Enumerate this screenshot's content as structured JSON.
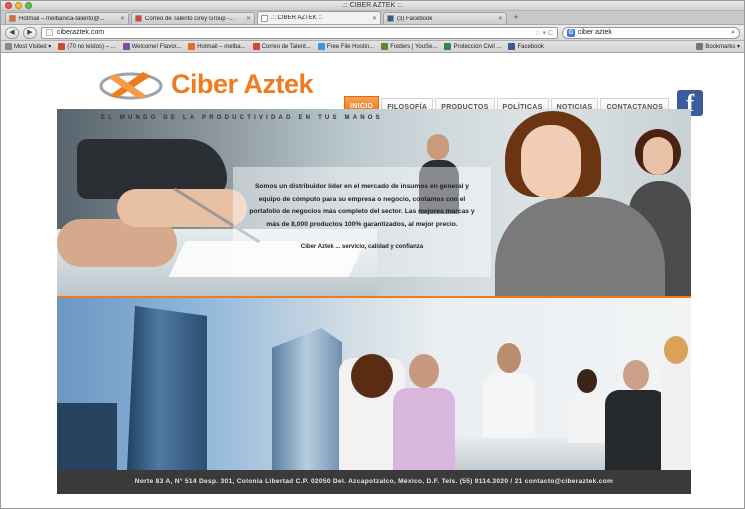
{
  "window": {
    "title": ".:: CIBER AZTEK ::."
  },
  "tabs": [
    {
      "label": "Hotmail – melbanica-talento@...",
      "icon_color": "#e56b2b"
    },
    {
      "label": "Correo de Talento Grey Group -...",
      "icon_color": "#d14836"
    },
    {
      "label": ".:: CIBER AZTEK ::.",
      "icon_color": "#ffffff",
      "active": true
    },
    {
      "label": "(3) Facebook",
      "icon_color": "#3b5998"
    }
  ],
  "navbar": {
    "back": "◀",
    "forward": "▶",
    "url": "ciberaztek.com",
    "url_controls": "☆ ▾ C",
    "search_value": "ciber aztek",
    "search_engine": "G"
  },
  "bookmarks": [
    {
      "label": "Most Visited ▾",
      "icon_color": "#8a8a8a"
    },
    {
      "label": "(70 no leídos) – ...",
      "icon_color": "#d14836"
    },
    {
      "label": "Welcome! Flavor...",
      "icon_color": "#7b4fa0"
    },
    {
      "label": "Hotmail – melba...",
      "icon_color": "#e56b2b"
    },
    {
      "label": "Correo de Talent...",
      "icon_color": "#d14836"
    },
    {
      "label": "Free File Hostin...",
      "icon_color": "#3a9ad9"
    },
    {
      "label": "Folders | YouSe...",
      "icon_color": "#5c8a2f"
    },
    {
      "label": "Protección Civil ...",
      "icon_color": "#2f8a4a"
    },
    {
      "label": "Facebook",
      "icon_color": "#3b5998"
    }
  ],
  "bookmarks_menu": "Bookmarks ▾",
  "site": {
    "brand": "Ciber Aztek",
    "nav": [
      "INICIO",
      "FILOSOFÍA",
      "PRODUCTOS",
      "POLÍTICAS",
      "NOTICIAS",
      "CONTACTANOS"
    ],
    "active_nav": "INICIO",
    "facebook_glyph": "f",
    "tagline": "EL MUNDO DE LA PRODUCTIVIDAD EN TUS MANOS",
    "intro": "Somos un distribuidor líder en el mercado de insumos en general y equipo de cómputo para su empresa o negocio, contamos con el portafolio de negocios más completo del sector. Las mejores marcas y más de 8,000 productos 100% garantizados, al mejor precio.",
    "slogan": "Ciber Aztek ... servicio, calidad y confianza",
    "footer": "Norte 83 A, N° 514 Desp. 301, Colonia Libertad  C.P. 02050 Del.  Azcapotzalco,  México, D.F.   Tels. (55) 9114.3020 / 21   contacto@ciberaztek.com",
    "colors": {
      "accent": "#f07a1f",
      "footer_bg": "#3a3a3a",
      "facebook": "#3b5b9a"
    }
  }
}
